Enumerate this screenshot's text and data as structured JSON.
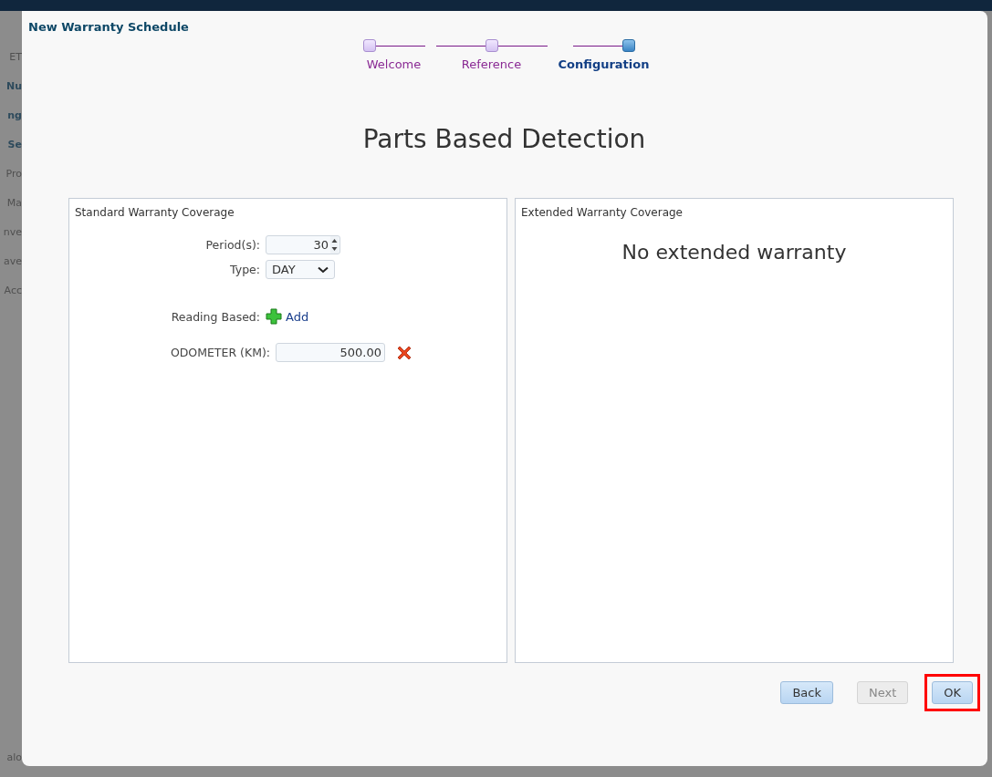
{
  "background": {
    "fragments": [
      {
        "text": "ET",
        "kind": "label"
      },
      {
        "text": "Nu",
        "kind": "heading"
      },
      {
        "text": "ng",
        "kind": "heading"
      },
      {
        "text": "Se",
        "kind": "heading"
      },
      {
        "text": "Pro",
        "kind": "label"
      },
      {
        "text": "Ma",
        "kind": "label"
      },
      {
        "text": "nve",
        "kind": "label"
      },
      {
        "text": "ave",
        "kind": "label"
      },
      {
        "text": "Acc",
        "kind": "label"
      },
      {
        "text": "alo",
        "kind": "footer"
      }
    ]
  },
  "dialog": {
    "title": "New Warranty Schedule",
    "steps": [
      {
        "label": "Welcome",
        "selected": false
      },
      {
        "label": "Reference",
        "selected": false
      },
      {
        "label": "Configuration",
        "selected": true
      }
    ],
    "heading": "Parts Based Detection",
    "standard": {
      "title": "Standard Warranty Coverage",
      "period_label": "Period(s):",
      "period_value": "30",
      "type_label": "Type:",
      "type_value": "DAY",
      "reading_label": "Reading Based:",
      "add_link": "Add",
      "readings": [
        {
          "label": "ODOMETER (KM):",
          "value": "500.00"
        }
      ]
    },
    "extended": {
      "title": "Extended Warranty Coverage",
      "message": "No extended warranty"
    },
    "buttons": [
      {
        "label": "Back",
        "disabled": false,
        "highlighted": false
      },
      {
        "label": "Next",
        "disabled": true,
        "highlighted": false
      },
      {
        "label": "OK",
        "disabled": false,
        "highlighted": true
      }
    ]
  }
}
